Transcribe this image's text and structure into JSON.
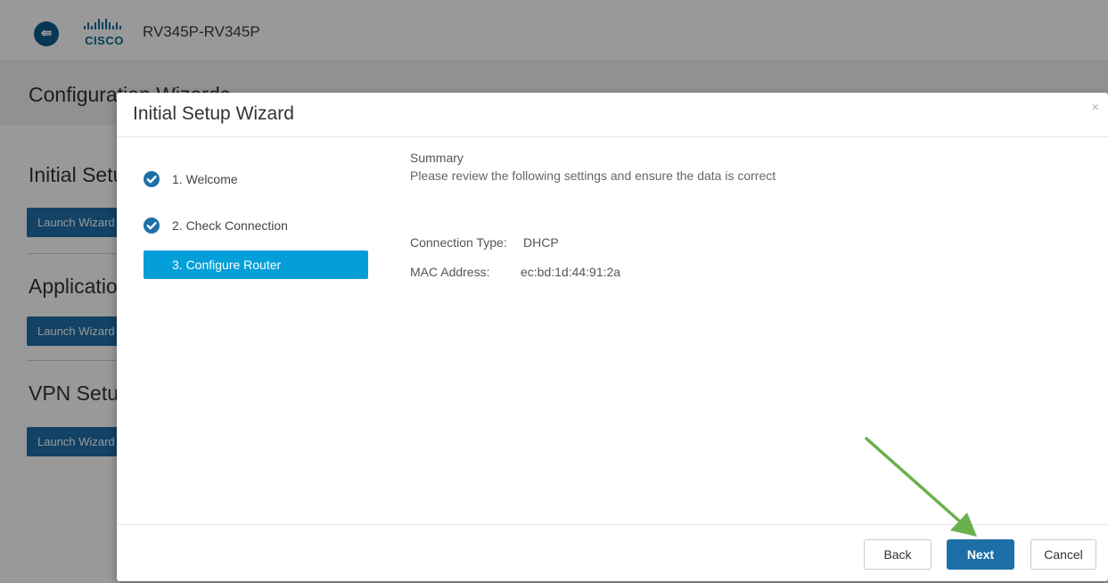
{
  "app": {
    "device_name": "RV345P-RV345P",
    "logo_text": "CISCO",
    "menu_icon": "sidebar-toggle-icon",
    "menu_glyph": "⇚"
  },
  "page": {
    "title": "Configuration Wizards",
    "sections": [
      {
        "title": "Initial Setup Wizard",
        "button_label": "Launch Wizard"
      },
      {
        "title": "Application Setup Wizard",
        "button_label": "Launch Wizard"
      },
      {
        "title": "VPN Setup Wizard",
        "button_label": "Launch Wizard"
      }
    ]
  },
  "modal": {
    "title": "Initial Setup Wizard",
    "close_glyph": "×",
    "steps": [
      {
        "label": "1. Welcome",
        "status": "complete"
      },
      {
        "label": "2. Check Connection",
        "status": "complete"
      },
      {
        "label": "3. Configure Router",
        "status": "active"
      }
    ],
    "summary": {
      "heading": "Summary",
      "description": "Please review the following settings and ensure the data is correct",
      "fields": [
        {
          "label": "Connection Type:",
          "value": "DHCP"
        },
        {
          "label": "MAC Address:",
          "value": "ec:bd:1d:44:91:2a"
        }
      ]
    },
    "buttons": {
      "back": "Back",
      "next": "Next",
      "cancel": "Cancel"
    }
  },
  "colors": {
    "primary": "#1e6fa8",
    "active_step": "#049fd9",
    "check": "#1e6fa8",
    "annotation_arrow": "#6ab04c"
  }
}
